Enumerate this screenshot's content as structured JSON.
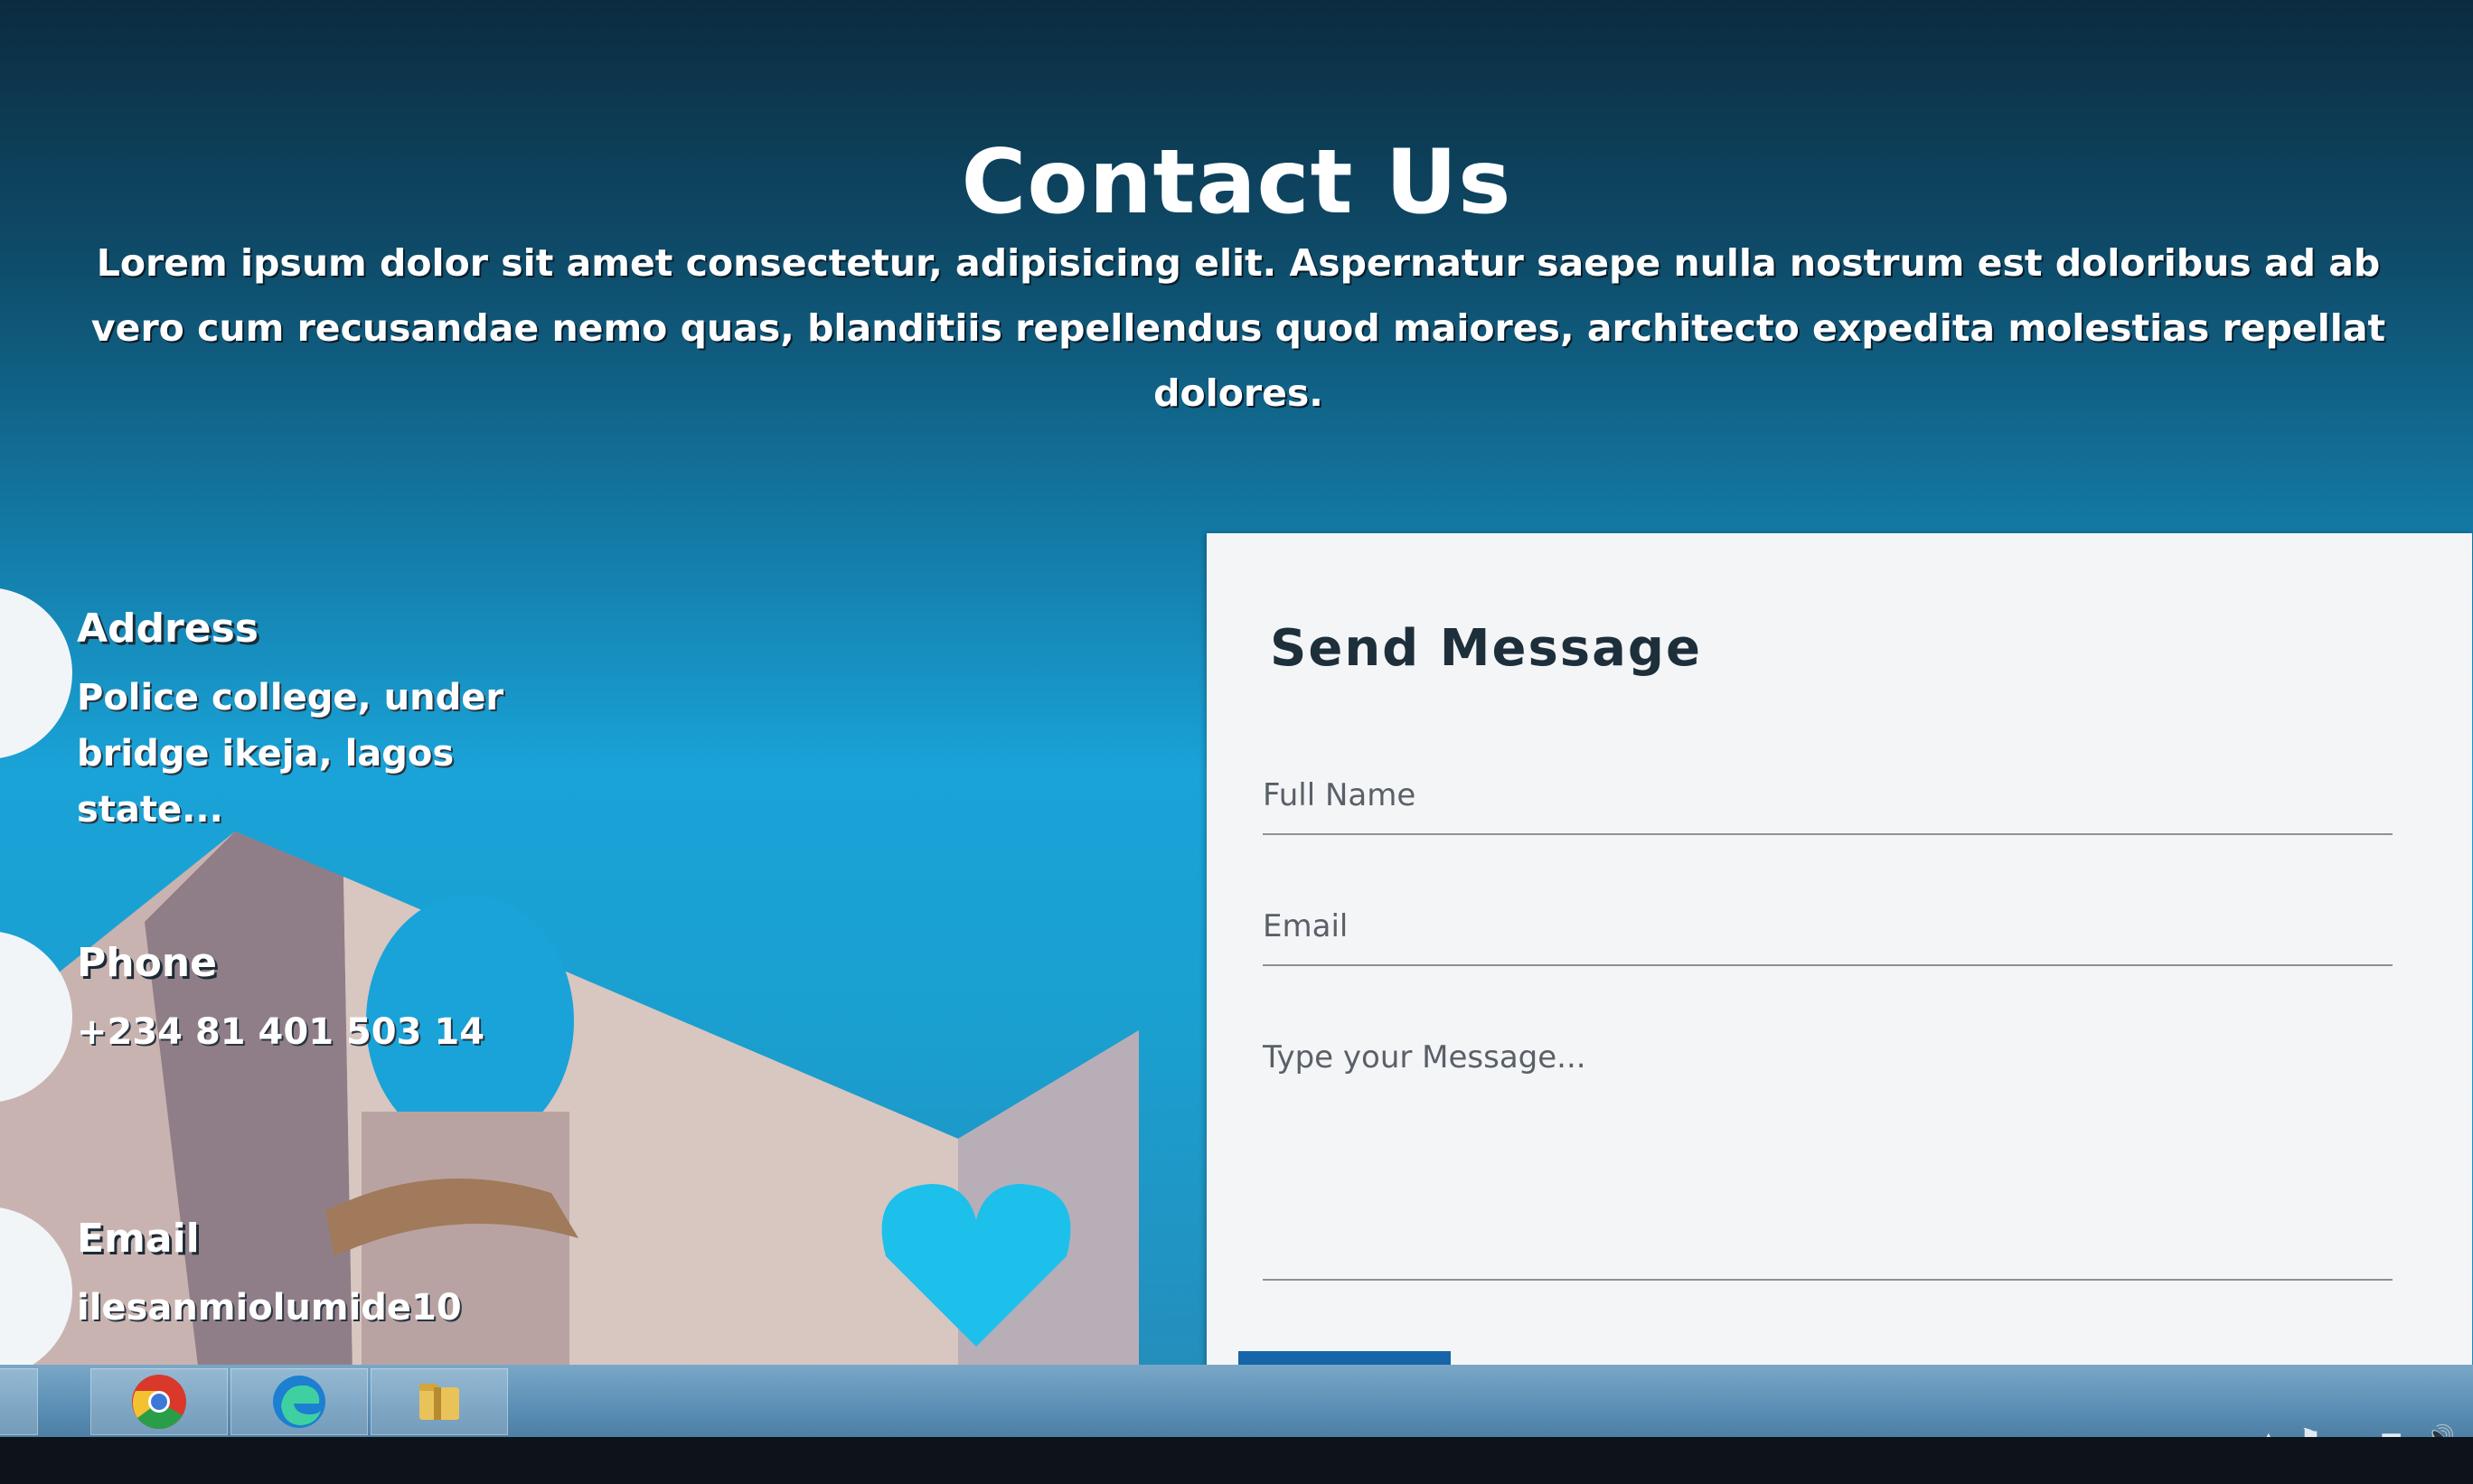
{
  "page": {
    "title": "Contact Us",
    "intro": "Lorem ipsum dolor sit amet consectetur, adipisicing elit. Aspernatur saepe nulla nostrum est doloribus ad ab vero cum recusandae nemo quas, blanditiis repellendus quod maiores, architecto expedita molestias repellat dolores."
  },
  "contact_info": {
    "address": {
      "label": "Address",
      "value": "Police college, under bridge ikeja, lagos state..."
    },
    "phone": {
      "label": "Phone",
      "value": "+234 81 401 503 14"
    },
    "email": {
      "label": "Email",
      "value": "ilesanmiolumide10"
    }
  },
  "form": {
    "title": "Send Message",
    "full_name_placeholder": "Full Name",
    "email_placeholder": "Email",
    "message_placeholder": "Type your Message..."
  },
  "taskbar": {
    "apps": [
      {
        "icon": "chrome-icon"
      },
      {
        "icon": "edge-icon"
      },
      {
        "icon": "file-explorer-icon"
      }
    ]
  },
  "colors": {
    "accent": "#1565a8",
    "card_background": "#f4f5f6",
    "hero_top": "#0c2b40",
    "hero_mid": "#1aa3d8"
  }
}
